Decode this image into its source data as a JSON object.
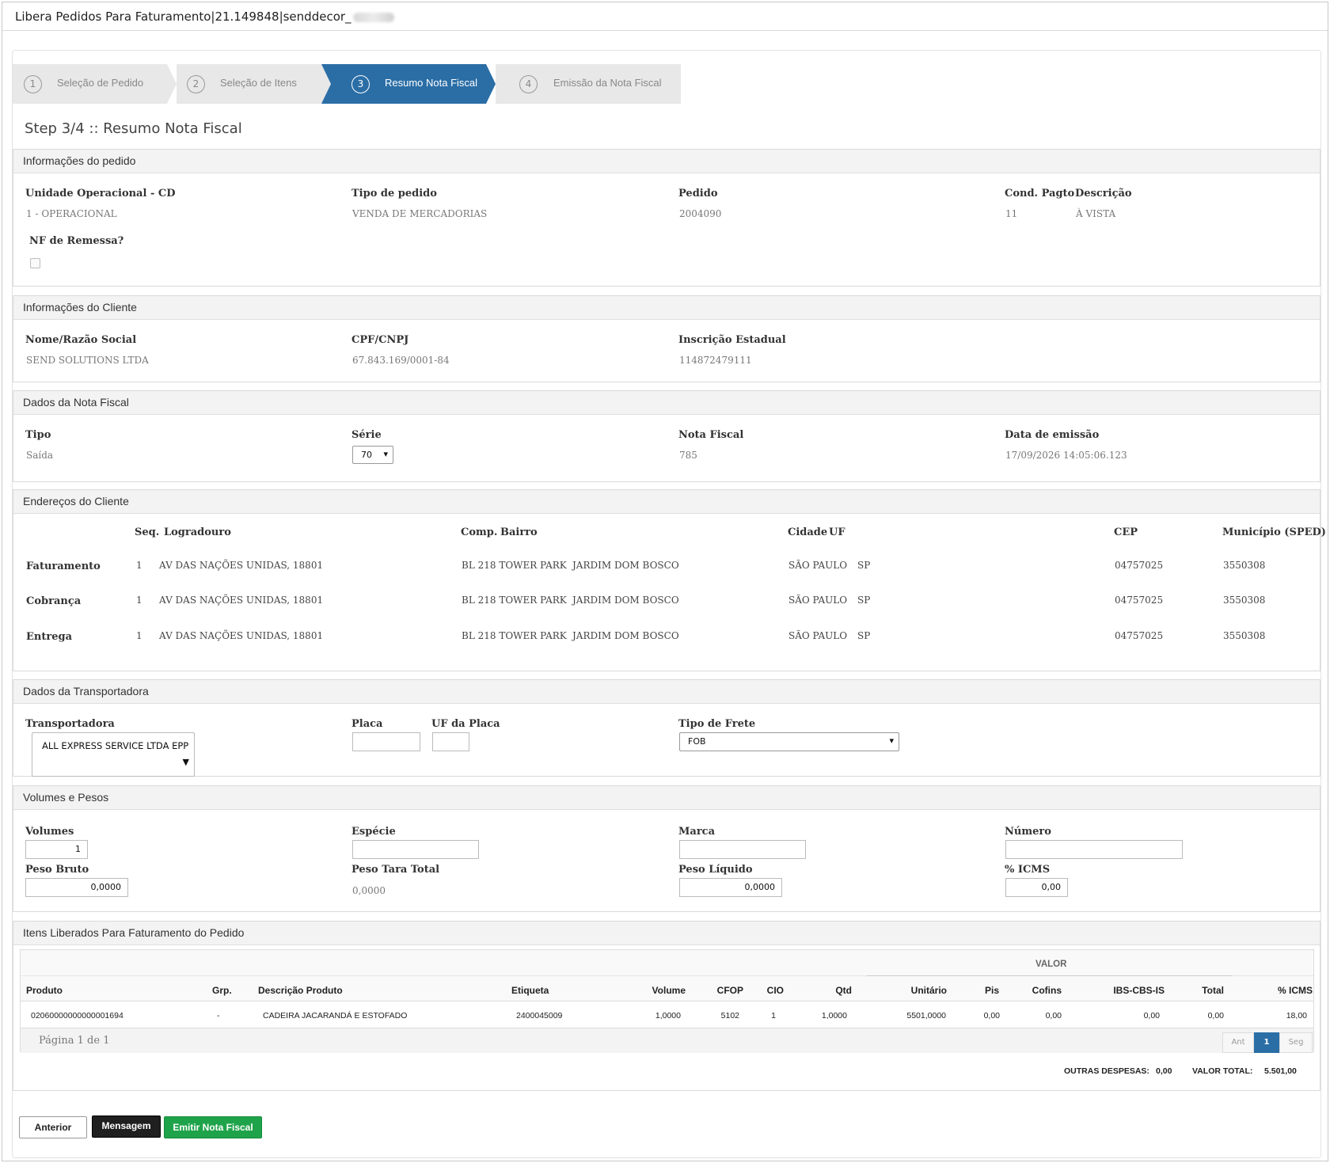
{
  "window": {
    "title": "Libera Pedidos Para Faturamento|21.149848|senddecor_"
  },
  "wizard": {
    "steps": [
      {
        "num": "1",
        "label": "Seleção de Pedido"
      },
      {
        "num": "2",
        "label": "Seleção de Itens"
      },
      {
        "num": "3",
        "label": "Resumo Nota Fiscal"
      },
      {
        "num": "4",
        "label": "Emissão da Nota Fiscal"
      }
    ],
    "active_index": 2,
    "active_color": "#2b6ea6"
  },
  "page_title": "Step 3/4 :: Resumo Nota Fiscal",
  "pedido": {
    "header": "Informações do pedido",
    "unidade_label": "Unidade Operacional - CD",
    "unidade_value": "1 - OPERACIONAL",
    "tipo_label": "Tipo de pedido",
    "tipo_value": "VENDA DE MERCADORIAS",
    "pedido_label": "Pedido",
    "pedido_value": "2004090",
    "cond_label": "Cond. Pagto",
    "cond_value": "11",
    "desc_label": "Descrição",
    "desc_value": "À VISTA",
    "remessa_label": "NF de Remessa?",
    "remessa_checked": false
  },
  "cliente": {
    "header": "Informações do Cliente",
    "nome_label": "Nome/Razão Social",
    "nome_value": "SEND SOLUTIONS LTDA",
    "cpf_label": "CPF/CNPJ",
    "cpf_value": "67.843.169/0001-84",
    "ie_label": "Inscrição Estadual",
    "ie_value": "114872479111"
  },
  "nota": {
    "header": "Dados da Nota Fiscal",
    "tipo_label": "Tipo",
    "tipo_value": "Saída",
    "serie_label": "Série",
    "serie_value": "70",
    "nf_label": "Nota Fiscal",
    "nf_value": "785",
    "data_label": "Data de emissão",
    "data_value": "17/09/2026 14:05:06.123"
  },
  "enderecos": {
    "header": "Endereços do Cliente",
    "columns": {
      "seq": "Seq.",
      "logradouro": "Logradouro",
      "comp": "Comp.",
      "bairro": "Bairro",
      "cidade": "Cidade",
      "uf": "UF",
      "cep": "CEP",
      "municipio": "Município (SPED)"
    },
    "rows": [
      {
        "tipo": "Faturamento",
        "seq": "1",
        "logradouro": "AV DAS NAÇÕES UNIDAS, 18801",
        "comp": "BL 218 TOWER PARK",
        "bairro": "JARDIM DOM BOSCO",
        "cidade": "SÃO PAULO",
        "uf": "SP",
        "cep": "04757025",
        "municipio": "3550308"
      },
      {
        "tipo": "Cobrança",
        "seq": "1",
        "logradouro": "AV DAS NAÇÕES UNIDAS, 18801",
        "comp": "BL 218 TOWER PARK",
        "bairro": "JARDIM DOM BOSCO",
        "cidade": "SÃO PAULO",
        "uf": "SP",
        "cep": "04757025",
        "municipio": "3550308"
      },
      {
        "tipo": "Entrega",
        "seq": "1",
        "logradouro": "AV DAS NAÇÕES UNIDAS, 18801",
        "comp": "BL 218 TOWER PARK",
        "bairro": "JARDIM DOM BOSCO",
        "cidade": "SÃO PAULO",
        "uf": "SP",
        "cep": "04757025",
        "municipio": "3550308"
      }
    ]
  },
  "transportadora": {
    "header": "Dados da Transportadora",
    "transp_label": "Transportadora",
    "transp_value": "ALL EXPRESS SERVICE LTDA EPP",
    "placa_label": "Placa",
    "placa_value": "",
    "ufplaca_label": "UF da Placa",
    "ufplaca_value": "",
    "frete_label": "Tipo de Frete",
    "frete_value": "FOB"
  },
  "volumes": {
    "header": "Volumes e Pesos",
    "volumes_label": "Volumes",
    "volumes_value": "1",
    "especie_label": "Espécie",
    "especie_value": "",
    "marca_label": "Marca",
    "marca_value": "",
    "numero_label": "Número",
    "numero_value": "",
    "pesobruto_label": "Peso Bruto",
    "pesobruto_value": "0,0000",
    "pesotara_label": "Peso Tara Total",
    "pesotara_value": "0,0000",
    "pesoliq_label": "Peso Líquido",
    "pesoliq_value": "0,0000",
    "icms_label": "% ICMS",
    "icms_value": "0,00"
  },
  "itens": {
    "header": "Itens Liberados Para Faturamento do Pedido",
    "group_label": "VALOR",
    "columns": {
      "produto": "Produto",
      "grp": "Grp.",
      "descricao": "Descrição Produto",
      "etiqueta": "Etiqueta",
      "volume": "Volume",
      "cfop": "CFOP",
      "cio": "CIO",
      "qtd": "Qtd",
      "unitario": "Unitário",
      "pis": "Pis",
      "cofins": "Cofins",
      "ibs": "IBS-CBS-IS",
      "total": "Total",
      "icms": "% ICMS"
    },
    "rows": [
      {
        "produto": "02060000000000001694",
        "grp": "-",
        "descricao": "CADEIRA JACARANDÁ E ESTOFADO",
        "etiqueta": "2400045009",
        "volume": "1,0000",
        "cfop": "5102",
        "cio": "1",
        "qtd": "1,0000",
        "unitario": "5501,0000",
        "pis": "0,00",
        "cofins": "0,00",
        "ibs": "0,00",
        "total": "0,00",
        "icms": "18,00"
      }
    ],
    "pagination": {
      "info": "Página 1 de 1",
      "prev": "Ant",
      "current": "1",
      "next": "Seg"
    },
    "outras_label": "OUTRAS DESPESAS:",
    "outras_value": "0,00",
    "total_label": "VALOR TOTAL:",
    "total_value": "5.501,00"
  },
  "buttons": {
    "anterior": "Anterior",
    "mensagem": "Mensagem",
    "emitir": "Emitir Nota Fiscal"
  }
}
